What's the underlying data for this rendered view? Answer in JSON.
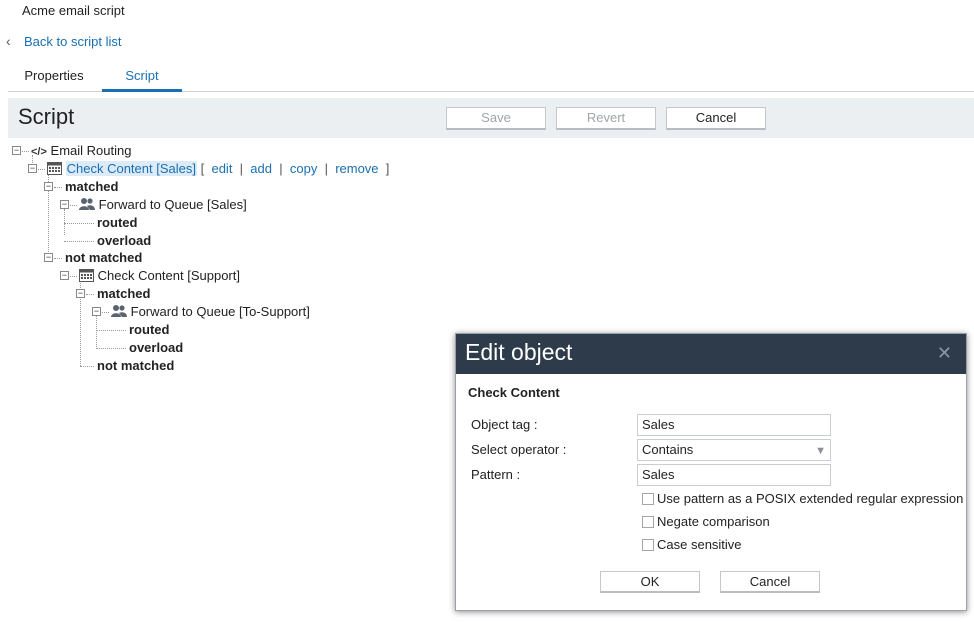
{
  "app": {
    "title": "Acme email script"
  },
  "nav": {
    "back_label": "Back to script list"
  },
  "tabs": [
    {
      "label": "Properties"
    },
    {
      "label": "Script"
    }
  ],
  "toolbar": {
    "title": "Script",
    "save_label": "Save",
    "revert_label": "Revert",
    "cancel_label": "Cancel"
  },
  "tree": {
    "root": "Email Routing",
    "check_sales": "Check Content [Sales]",
    "actions": {
      "open": "[",
      "edit": "edit",
      "add": "add",
      "copy": "copy",
      "remove": "remove",
      "close": "]",
      "sep": "|"
    },
    "matched": "matched",
    "forward_sales": "Forward to Queue [Sales]",
    "routed": "routed",
    "overload": "overload",
    "not_matched": "not matched",
    "check_support": "Check Content [Support]",
    "matched2": "matched",
    "forward_support": "Forward to Queue [To-Support]",
    "routed2": "routed",
    "overload2": "overload",
    "not_matched2": "not matched",
    "icons": {
      "root": "code-icon",
      "check": "calendar-icon",
      "queue": "users-icon"
    }
  },
  "dialog": {
    "title": "Edit object",
    "subtitle": "Check Content",
    "object_tag_label": "Object tag :",
    "object_tag_value": "Sales",
    "operator_label": "Select operator :",
    "operator_value": "Contains",
    "pattern_label": "Pattern :",
    "pattern_value": "Sales",
    "options": [
      {
        "label": "Use pattern as a POSIX extended regular expression",
        "checked": false
      },
      {
        "label": "Negate comparison",
        "checked": false
      },
      {
        "label": "Case sensitive",
        "checked": false
      }
    ],
    "ok_label": "OK",
    "cancel_label": "Cancel"
  },
  "colors": {
    "accent": "#1a6fb3",
    "dialog_header": "#2e3b4a",
    "toolbar_bg": "#eceff1"
  }
}
